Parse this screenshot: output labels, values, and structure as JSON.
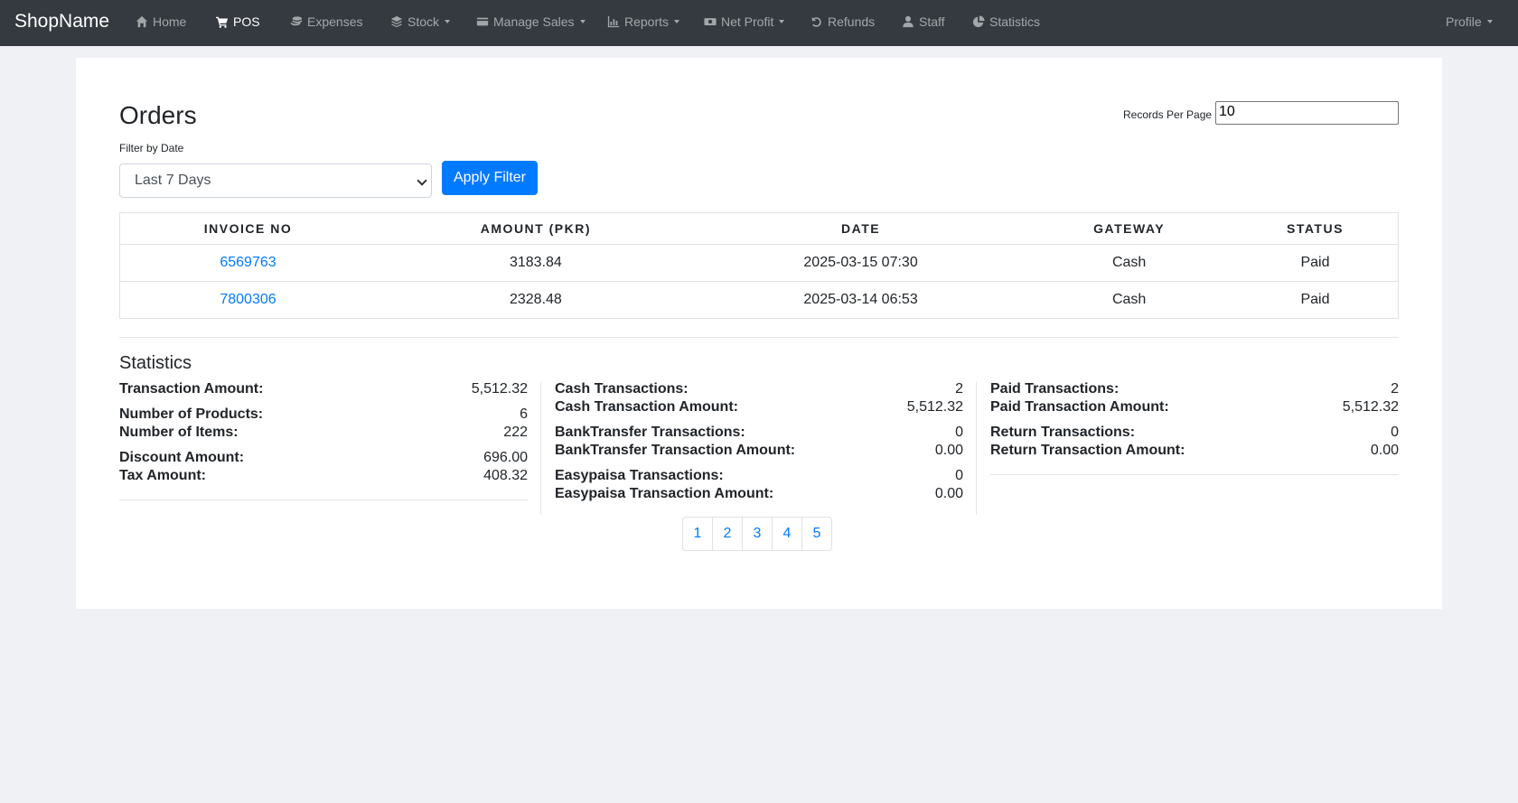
{
  "navbar": {
    "brand": "ShopName",
    "items": [
      {
        "label": "Home",
        "icon": "home-icon",
        "dropdown": false
      },
      {
        "label": "POS",
        "icon": "cart-icon",
        "dropdown": false,
        "active": true
      },
      {
        "label": "Expenses",
        "icon": "coins-icon",
        "dropdown": false
      },
      {
        "label": "Stock",
        "icon": "layers-icon",
        "dropdown": true
      },
      {
        "label": "Manage Sales",
        "icon": "credit-card-icon",
        "dropdown": true
      },
      {
        "label": "Reports",
        "icon": "chart-icon",
        "dropdown": true
      },
      {
        "label": "Net Profit",
        "icon": "money-icon",
        "dropdown": true
      },
      {
        "label": "Refunds",
        "icon": "undo-icon",
        "dropdown": false
      },
      {
        "label": "Staff",
        "icon": "user-icon",
        "dropdown": false
      },
      {
        "label": "Statistics",
        "icon": "pie-chart-icon",
        "dropdown": false
      }
    ],
    "profile": "Profile"
  },
  "page": {
    "title": "Orders",
    "filter_label": "Filter by Date",
    "filter_value": "Last 7 Days",
    "apply_label": "Apply Filter",
    "rpp_label": "Records Per Page",
    "rpp_value": "10"
  },
  "table": {
    "headers": [
      "INVOICE NO",
      "AMOUNT (PKR)",
      "DATE",
      "GATEWAY",
      "STATUS"
    ],
    "rows": [
      {
        "invoice": "6569763",
        "amount": "3183.84",
        "date": "2025-03-15 07:30",
        "gateway": "Cash",
        "status": "Paid"
      },
      {
        "invoice": "7800306",
        "amount": "2328.48",
        "date": "2025-03-14 06:53",
        "gateway": "Cash",
        "status": "Paid"
      }
    ]
  },
  "stats": {
    "title": "Statistics",
    "col1": [
      [
        {
          "k": "Transaction Amount:",
          "v": "5,512.32"
        }
      ],
      [
        {
          "k": "Number of Products:",
          "v": "6"
        },
        {
          "k": "Number of Items:",
          "v": "222"
        }
      ],
      [
        {
          "k": "Discount Amount:",
          "v": "696.00"
        },
        {
          "k": "Tax Amount:",
          "v": "408.32"
        }
      ]
    ],
    "col2": [
      [
        {
          "k": "Cash Transactions:",
          "v": "2"
        },
        {
          "k": "Cash Transaction Amount:",
          "v": "5,512.32"
        }
      ],
      [
        {
          "k": "BankTransfer Transactions:",
          "v": "0"
        },
        {
          "k": "BankTransfer Transaction Amount:",
          "v": "0.00"
        }
      ],
      [
        {
          "k": "Easypaisa Transactions:",
          "v": "0"
        },
        {
          "k": "Easypaisa Transaction Amount:",
          "v": "0.00"
        }
      ]
    ],
    "col3": [
      [
        {
          "k": "Paid Transactions:",
          "v": "2"
        },
        {
          "k": "Paid Transaction Amount:",
          "v": "5,512.32"
        }
      ],
      [
        {
          "k": "Return Transactions:",
          "v": "0"
        },
        {
          "k": "Return Transaction Amount:",
          "v": "0.00"
        }
      ]
    ]
  },
  "pagination": [
    "1",
    "2",
    "3",
    "4",
    "5"
  ]
}
